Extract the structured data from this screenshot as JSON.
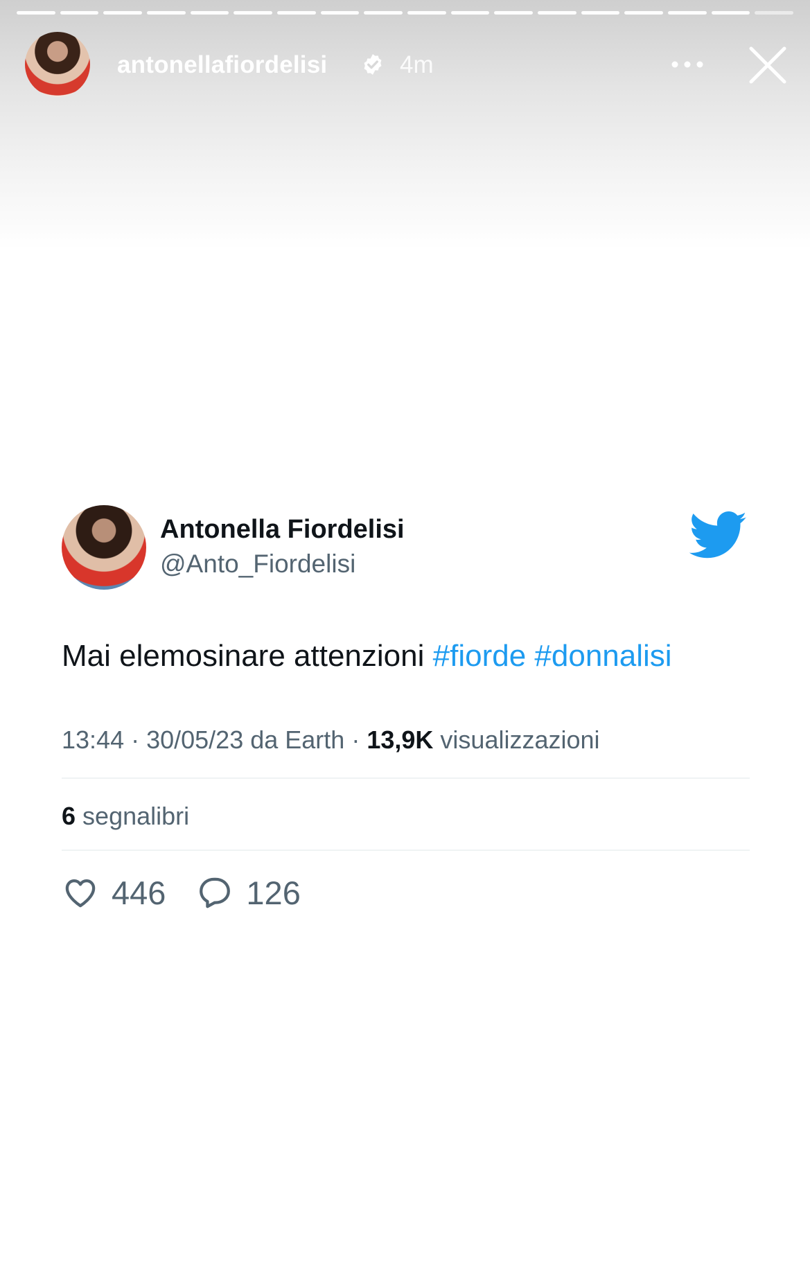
{
  "story": {
    "username": "antonellafiordelisi",
    "time": "4m",
    "progress_segments": 18,
    "active_segment": 18
  },
  "tweet": {
    "display_name": "Antonella Fiordelisi",
    "handle": "@Anto_Fiordelisi",
    "text": "Mai elemosinare attenzioni",
    "hashtags": [
      "#fiorde",
      "#donnalisi"
    ],
    "meta": {
      "time": "13:44",
      "date": "30/05/23 da Earth",
      "views_count": "13,9K",
      "views_label": "visualizzazioni"
    },
    "bookmarks": {
      "count": "6",
      "label": "segnalibri"
    },
    "likes": "446",
    "replies": "126"
  },
  "colors": {
    "twitter_blue": "#1d9bf0",
    "text_primary": "#0f1419",
    "text_secondary": "#536471"
  },
  "icons": [
    "verified-icon",
    "more-icon",
    "close-icon",
    "twitter-bird-icon",
    "heart-icon",
    "reply-icon"
  ]
}
